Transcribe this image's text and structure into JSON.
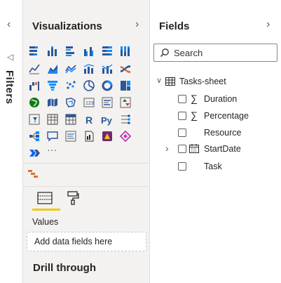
{
  "filters": {
    "label": "Filters"
  },
  "visualizations": {
    "title": "Visualizations",
    "values_label": "Values",
    "well_placeholder": "Add data fields here",
    "drill_through": "Drill through",
    "more": "···"
  },
  "fields": {
    "title": "Fields",
    "search_placeholder": "Search",
    "table": "Tasks-sheet",
    "items": [
      {
        "name": "Duration",
        "kind": "sigma"
      },
      {
        "name": "Percentage",
        "kind": "sigma"
      },
      {
        "name": "Resource",
        "kind": "text"
      },
      {
        "name": "StartDate",
        "kind": "date"
      },
      {
        "name": "Task",
        "kind": "text"
      }
    ]
  },
  "colors": {
    "accent_yellow": "#f2c811",
    "icon_blue": "#2b579a",
    "icon_teal": "#118dff",
    "pane_bg": "#f3f2f1"
  }
}
